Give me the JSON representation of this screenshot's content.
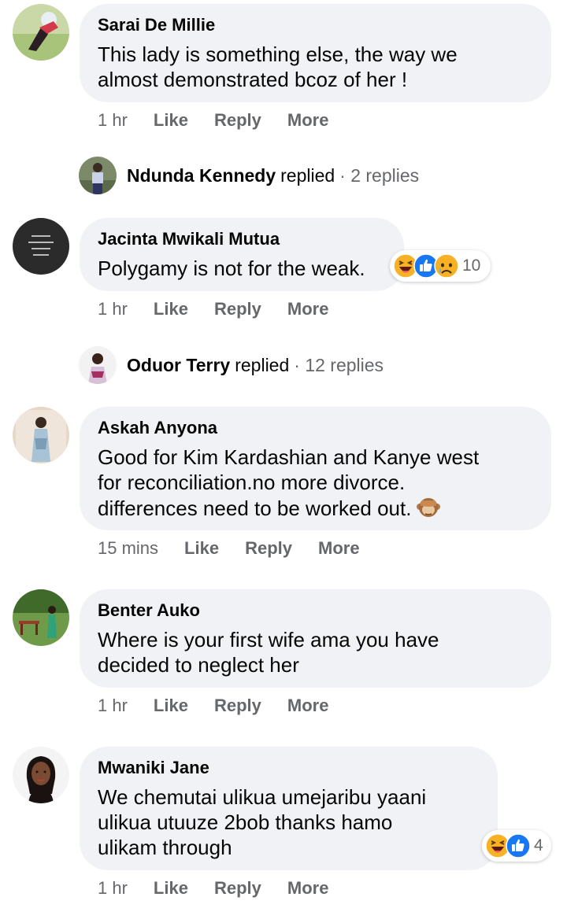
{
  "comments": [
    {
      "author": "Sarai De Millie",
      "text": [
        "This lady is something else, the way we",
        "almost demonstrated bcoz of her !"
      ],
      "time": "1 hr",
      "actions": [
        "Like",
        "Reply",
        "More"
      ],
      "reply_summary": {
        "name": "Ndunda Kennedy",
        "verb": "replied",
        "count": "· 2 replies"
      }
    },
    {
      "author": "Jacinta Mwikali Mutua",
      "text": [
        "Polygamy is not for the weak."
      ],
      "time": "1 hr",
      "actions": [
        "Like",
        "Reply",
        "More"
      ],
      "reactions": {
        "icons": [
          "haha-icon",
          "like-icon",
          "sad-icon"
        ],
        "count": "10"
      },
      "reply_summary": {
        "name": "Oduor Terry",
        "verb": "replied",
        "count": "· 12 replies"
      }
    },
    {
      "author": "Askah Anyona",
      "text": [
        "Good for Kim Kardashian and Kanye west",
        "for reconciliation.no more divorce.",
        "differences need to be worked out."
      ],
      "inline_emoji": "see-no-evil-monkey-icon",
      "time": "15 mins",
      "actions": [
        "Like",
        "Reply",
        "More"
      ]
    },
    {
      "author": "Benter Auko",
      "text": [
        "Where is your first wife ama you have",
        "decided to neglect her"
      ],
      "time": "1 hr",
      "actions": [
        "Like",
        "Reply",
        "More"
      ]
    },
    {
      "author": "Mwaniki Jane",
      "text": [
        "We chemutai ulikua umejaribu yaani",
        "ulikua utuuze 2bob thanks hamo",
        "ulikam through"
      ],
      "time": "1 hr",
      "actions": [
        "Like",
        "Reply",
        "More"
      ],
      "reactions": {
        "icons": [
          "haha-icon",
          "like-icon"
        ],
        "count": "4"
      }
    }
  ],
  "colors": {
    "bubble": "#f0f2f5",
    "secondary_text": "#65676b",
    "like_blue": "#1877f2",
    "emoji_yellow": "#f7b125"
  }
}
